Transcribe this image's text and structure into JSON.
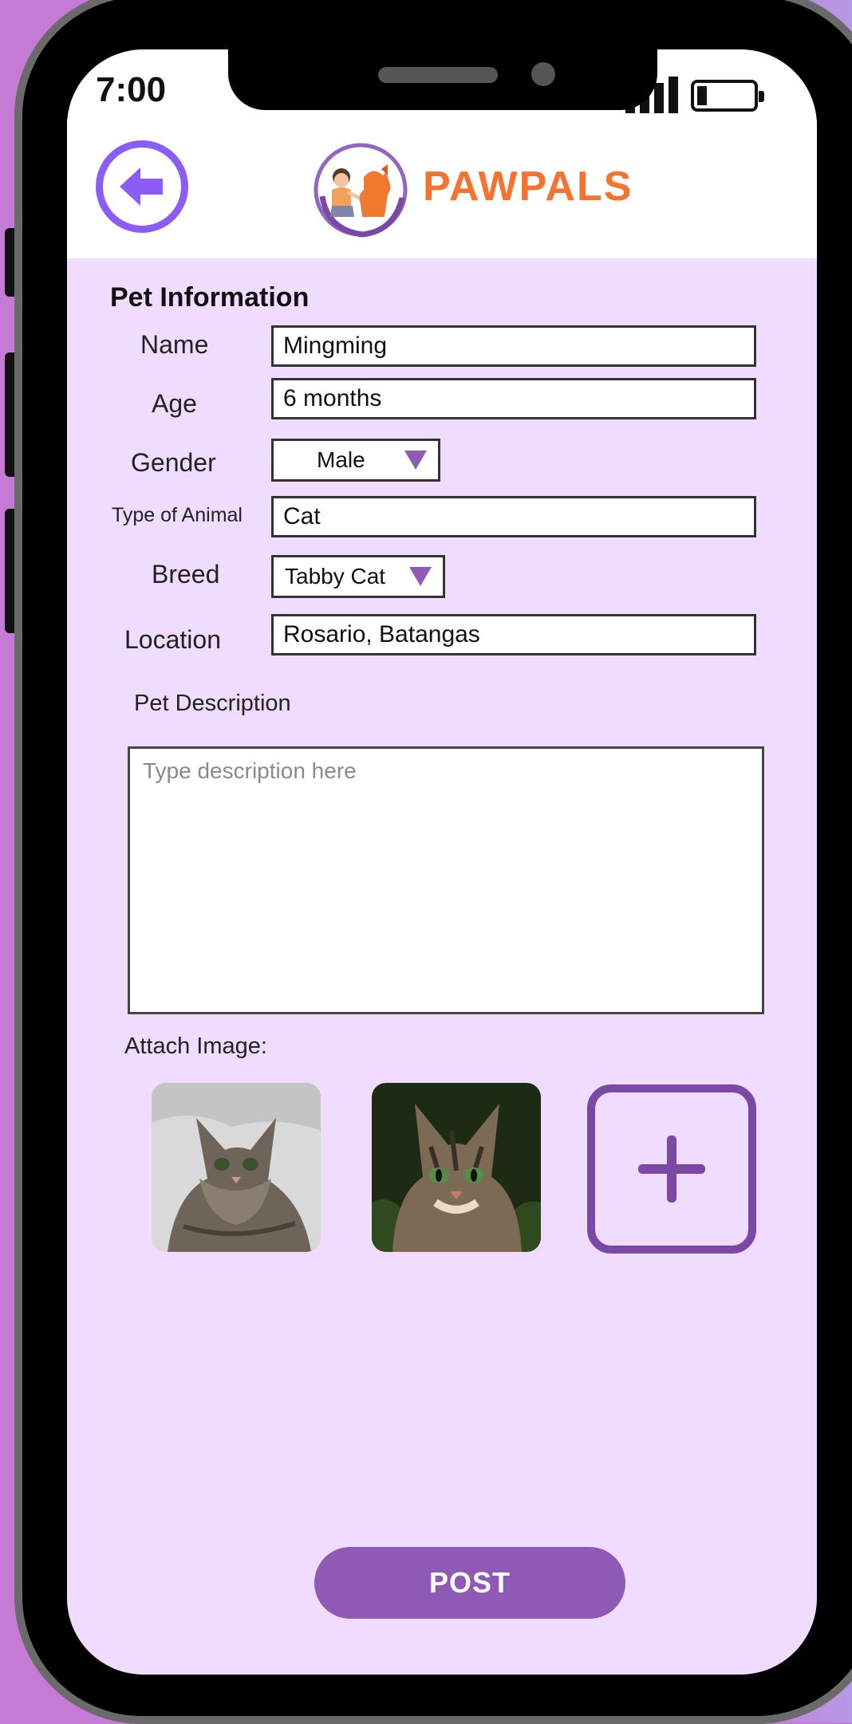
{
  "status_bar": {
    "time": "7:00"
  },
  "header": {
    "brand": "PAWPALS"
  },
  "form": {
    "section_title": "Pet Information",
    "name": {
      "label": "Name",
      "value": "Mingming"
    },
    "age": {
      "label": "Age",
      "value": "6 months"
    },
    "gender": {
      "label": "Gender",
      "value": "Male"
    },
    "animal_type": {
      "label": "Type of Animal",
      "value": "Cat"
    },
    "breed": {
      "label": "Breed",
      "value": "Tabby Cat"
    },
    "location": {
      "label": "Location",
      "value": "Rosario, Batangas"
    },
    "description": {
      "label": "Pet Description",
      "placeholder": "Type description here"
    },
    "attach": {
      "label": "Attach Image:"
    }
  },
  "actions": {
    "post_label": "POST"
  },
  "colors": {
    "accent": "#8e5ab5",
    "back_accent": "#8b5cf6",
    "brand": "#f5732f",
    "background": "#f0dcff"
  }
}
